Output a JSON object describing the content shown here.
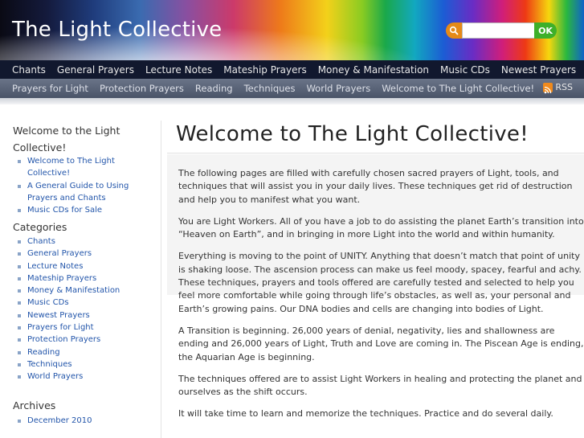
{
  "site": {
    "title": "The Light Collective"
  },
  "search": {
    "placeholder": "",
    "value": "",
    "button_label": "OK"
  },
  "nav_primary": [
    "Chants",
    "General Prayers",
    "Lecture Notes",
    "Mateship Prayers",
    "Money & Manifestation",
    "Music CDs",
    "Newest Prayers"
  ],
  "nav_secondary": [
    "Prayers for Light",
    "Protection Prayers",
    "Reading",
    "Techniques",
    "World Prayers",
    "Welcome to The Light Collective!"
  ],
  "rss_label": "RSS",
  "sidebar": {
    "welcome": {
      "heading": "Welcome to the Light Collective!",
      "items": [
        "Welcome to The Light Collective!",
        "A General Guide to Using Prayers and Chants",
        "Music CDs for Sale"
      ]
    },
    "categories": {
      "heading": "Categories",
      "items": [
        "Chants",
        "General Prayers",
        "Lecture Notes",
        "Mateship Prayers",
        "Money & Manifestation",
        "Music CDs",
        "Newest Prayers",
        "Prayers for Light",
        "Protection Prayers",
        "Reading",
        "Techniques",
        "World Prayers"
      ]
    },
    "archives": {
      "heading": "Archives",
      "items": [
        "December 2010"
      ]
    }
  },
  "main": {
    "title": "Welcome to The Light Collective!",
    "paragraphs": [
      "The following pages are filled with carefully chosen sacred prayers of Light, tools, and techniques that will assist you in your daily lives. These techniques get rid of destruction and help you to manifest what you want.",
      "You are Light Workers.  All of you have a job to do assisting the planet Earth’s transition into “Heaven on Earth”, and in bringing in more Light into the world and within humanity.",
      "Everything is moving to the point of UNITY. Anything that doesn’t match that point of unity is shaking loose. The ascension process can make us feel moody, spacey, fearful and achy. These techniques, prayers and tools offered are carefully tested and selected to help you feel more comfortable while going through life’s obstacles, as well as, your personal and Earth’s growing pains. Our DNA bodies and cells are changing into bodies of Light.",
      "A Transition is beginning. 26,000 years of denial, negativity, lies and shallowness are ending and 26,000 years of Light, Truth and Love are coming in. The Piscean Age is ending, the Aquarian Age is beginning.",
      "The techniques offered are to assist Light Workers in healing and protecting the planet and ourselves as the shift occurs.",
      "It will take time to learn and memorize the techniques. Practice and do several daily."
    ]
  }
}
